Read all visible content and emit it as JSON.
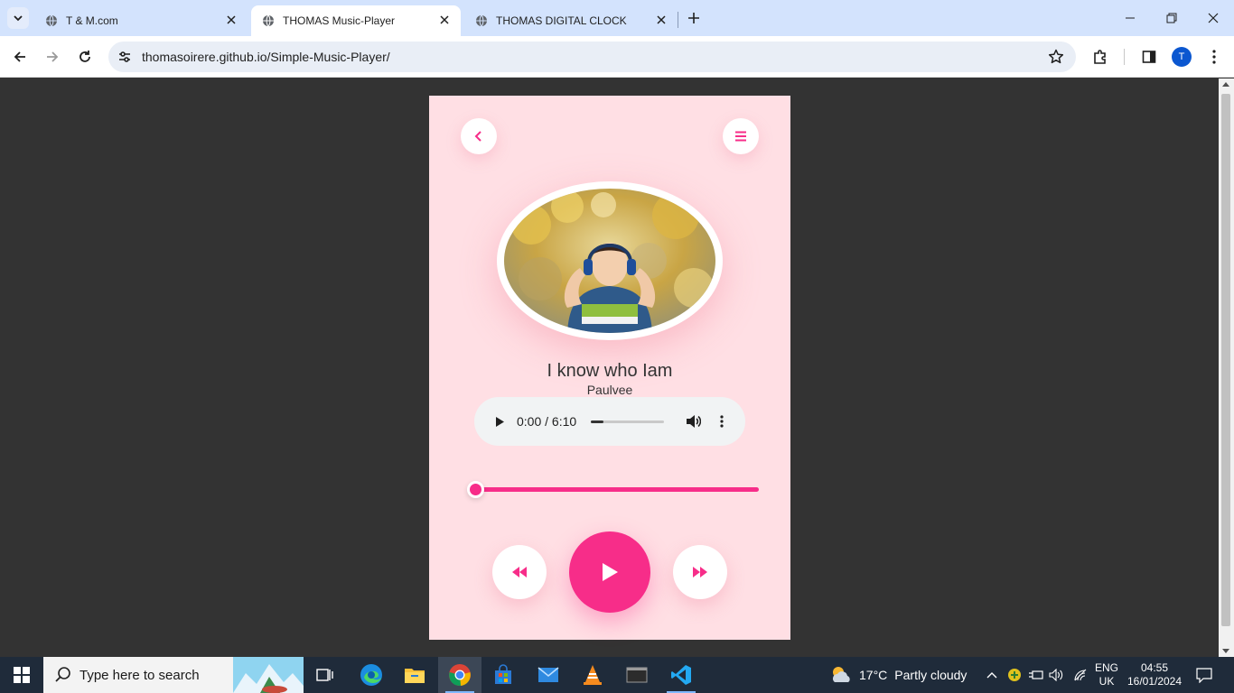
{
  "browser": {
    "tabs": [
      {
        "title": "T & M.com",
        "active": false
      },
      {
        "title": "THOMAS Music-Player",
        "active": true
      },
      {
        "title": "THOMAS DIGITAL CLOCK",
        "active": false
      }
    ],
    "url": "thomasoirere.github.io/Simple-Music-Player/",
    "profile_initial": "T"
  },
  "player": {
    "song_title": "I know who Iam",
    "artist": "Paulvee",
    "audio_time": "0:00 / 6:10",
    "audio_progress_fraction": 0.17,
    "seek_position_fraction": 0.0,
    "accent_color": "#f72d89",
    "background_color": "#ffdfe4"
  },
  "taskbar": {
    "search_placeholder": "Type here to search",
    "weather": {
      "temp": "17°C",
      "condition": "Partly cloudy"
    },
    "language": {
      "line1": "ENG",
      "line2": "UK"
    },
    "clock": {
      "time": "04:55",
      "date": "16/01/2024"
    }
  }
}
